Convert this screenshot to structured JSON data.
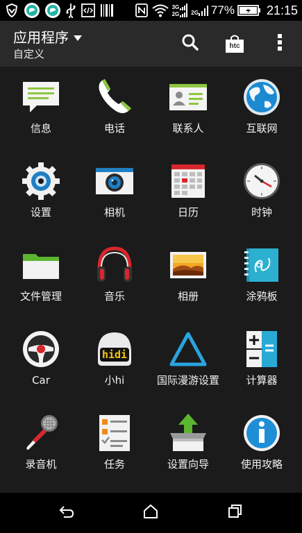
{
  "status_bar": {
    "network_top": "3G",
    "network_bottom": "2G",
    "network_2": "2G",
    "battery": "77%",
    "time": "21:15"
  },
  "action_bar": {
    "title": "应用程序",
    "subtitle": "自定义",
    "store_label": "htc"
  },
  "apps": [
    {
      "label": "信息",
      "icon": "messages-icon"
    },
    {
      "label": "电话",
      "icon": "phone-icon"
    },
    {
      "label": "联系人",
      "icon": "contacts-icon"
    },
    {
      "label": "互联网",
      "icon": "internet-icon"
    },
    {
      "label": "设置",
      "icon": "settings-icon"
    },
    {
      "label": "相机",
      "icon": "camera-icon"
    },
    {
      "label": "日历",
      "icon": "calendar-icon"
    },
    {
      "label": "时钟",
      "icon": "clock-icon"
    },
    {
      "label": "文件管理",
      "icon": "folder-icon"
    },
    {
      "label": "音乐",
      "icon": "headphones-icon"
    },
    {
      "label": "相册",
      "icon": "gallery-icon"
    },
    {
      "label": "涂鸦板",
      "icon": "scribble-icon"
    },
    {
      "label": "Car",
      "icon": "steering-wheel-icon"
    },
    {
      "label": "小hi",
      "icon": "hidi-icon",
      "badge": "hidi"
    },
    {
      "label": "国际漫游设置",
      "icon": "roaming-icon"
    },
    {
      "label": "计算器",
      "icon": "calculator-icon"
    },
    {
      "label": "录音机",
      "icon": "microphone-icon"
    },
    {
      "label": "任务",
      "icon": "tasks-icon"
    },
    {
      "label": "设置向导",
      "icon": "setup-wizard-icon"
    },
    {
      "label": "使用攻略",
      "icon": "info-icon"
    }
  ],
  "colors": {
    "background": "#1b1b1b",
    "action_bar": "#2a2a2a",
    "accent_green": "#8dc63f",
    "accent_blue": "#1e8fd6"
  }
}
